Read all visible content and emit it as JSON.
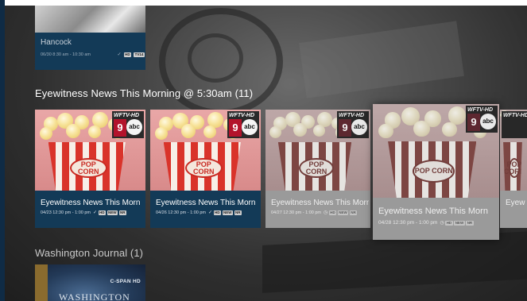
{
  "sections": {
    "top": {
      "card": {
        "title": "Hancock",
        "meta": "06/30 8:30 am - 10:30 am",
        "check": "✓",
        "badges": [
          "HD",
          "TV14"
        ]
      }
    },
    "eyewitness": {
      "title": "Eyewitness News This Morning @ 5:30am (11)",
      "cards": [
        {
          "title": "Eyewitness News This Morn",
          "meta": "04/23 12:30 pm - 1:00 pm",
          "status": "✓",
          "badges": [
            "HD",
            "NEW",
            "NR"
          ],
          "channel_call": "WFTV-HD",
          "channel_num": "9",
          "network": "abc"
        },
        {
          "title": "Eyewitness News This Morn",
          "meta": "04/26 12:30 pm - 1:00 pm",
          "status": "✓",
          "badges": [
            "HD",
            "NEW",
            "NR"
          ],
          "channel_call": "WFTV-HD",
          "channel_num": "9",
          "network": "abc"
        },
        {
          "title": "Eyewitness News This Morn",
          "meta": "04/27 12:30 pm - 1:00 pm",
          "status": "◷",
          "badges": [
            "HD",
            "NEW",
            "NR"
          ],
          "channel_call": "WFTV-HD",
          "channel_num": "9",
          "network": "abc"
        },
        {
          "title": "Eyewitness News This Morn",
          "meta": "04/28 12:30 pm - 1:00 pm",
          "status": "◷",
          "badges": [
            "HD",
            "NEW",
            "NR"
          ],
          "channel_call": "WFTV-HD",
          "channel_num": "9",
          "network": "abc"
        },
        {
          "title": "Eyewitn",
          "channel_call": "WFTV-HD"
        }
      ],
      "art_text": "POP CORN"
    },
    "washington": {
      "title": "Washington Journal (1)",
      "card": {
        "art_text_top": "C-SPAN HD",
        "art_text_main": "WASHINGTON"
      }
    }
  },
  "colors": {
    "card_blue": "#133a57",
    "card_gray": "#9a9a9a",
    "sidebar": "#0f2b45",
    "channel_red": "#b3132b"
  }
}
